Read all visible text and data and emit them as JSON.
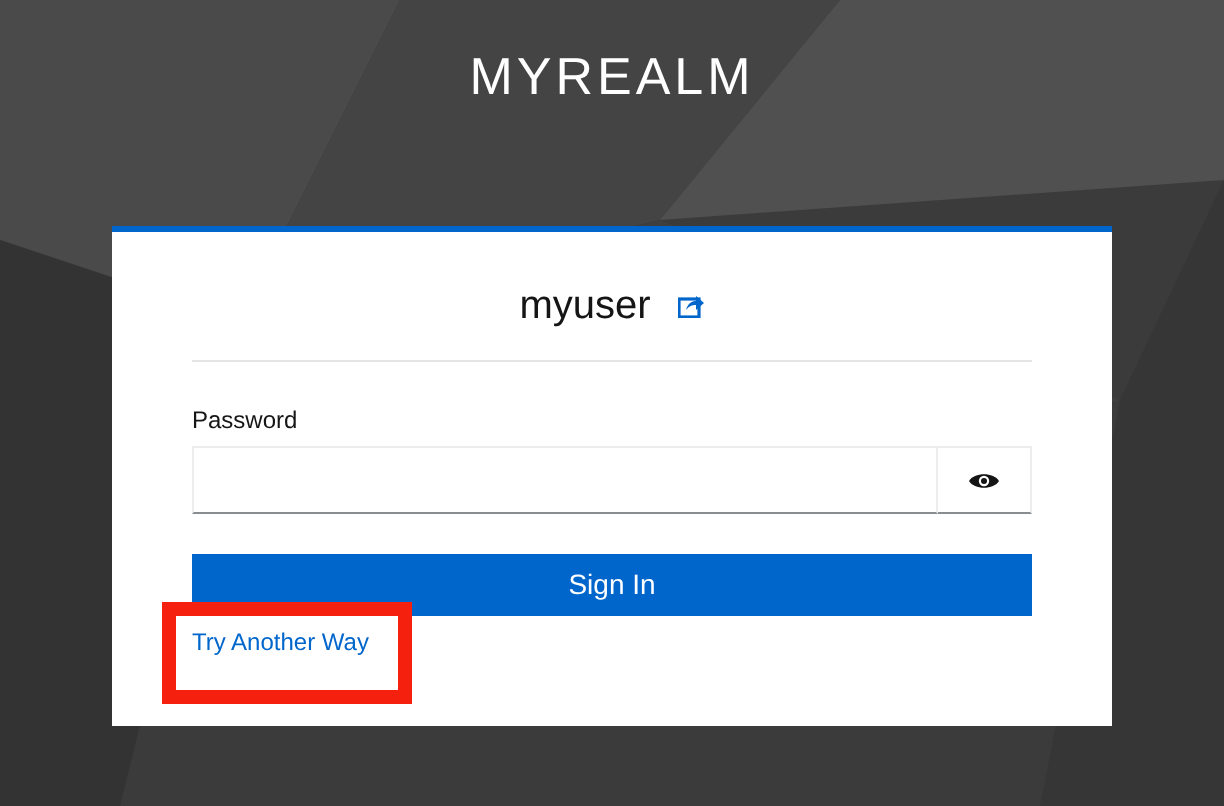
{
  "realm_title": "MYREALM",
  "username": "myuser",
  "password": {
    "label": "Password"
  },
  "sign_in_button": "Sign In",
  "try_another_way_link": "Try Another Way"
}
